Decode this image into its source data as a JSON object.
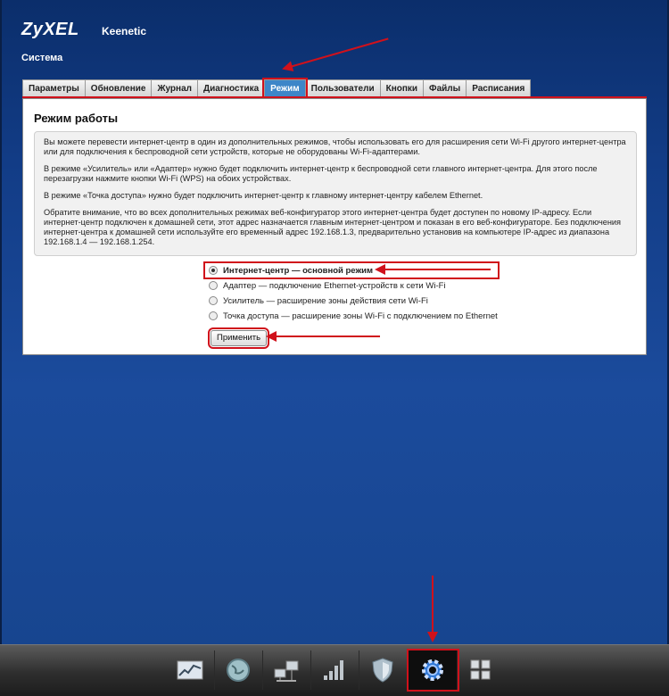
{
  "header": {
    "logo": "ZyXEL",
    "product": "Keenetic",
    "section_title": "Система"
  },
  "tabs": [
    {
      "label": "Параметры",
      "active": false
    },
    {
      "label": "Обновление",
      "active": false
    },
    {
      "label": "Журнал",
      "active": false
    },
    {
      "label": "Диагностика",
      "active": false
    },
    {
      "label": "Режим",
      "active": true
    },
    {
      "label": "Пользователи",
      "active": false
    },
    {
      "label": "Кнопки",
      "active": false
    },
    {
      "label": "Файлы",
      "active": false
    },
    {
      "label": "Расписания",
      "active": false
    }
  ],
  "panel": {
    "title": "Режим работы",
    "info": [
      "Вы можете перевести интернет-центр в один из дополнительных режимов, чтобы использовать его для расширения сети Wi-Fi другого интернет-центра или для подключения к беспроводной сети устройств, которые не оборудованы Wi-Fi-адаптерами.",
      "В режиме «Усилитель» или «Адаптер» нужно будет подключить интернет-центр к беспроводной сети главного интернет-центра. Для этого после перезагрузки нажмите кнопки Wi-Fi (WPS) на обоих устройствах.",
      "В режиме «Точка доступа» нужно будет подключить интернет-центр к главному интернет-центру кабелем Ethernet.",
      "Обратите внимание, что во всех дополнительных режимах веб-конфигуратор этого интернет-центра будет доступен по новому IP-адресу. Если интернет-центр подключен к домашней сети, этот адрес назначается главным интернет-центром и показан в его веб-конфигураторе. Без подключения интернет-центра к домашней сети используйте его временный адрес 192.168.1.3, предварительно установив на компьютере IP-адрес из диапазона 192.168.1.4 — 192.168.1.254."
    ],
    "modes": [
      {
        "label": "Интернет-центр — основной режим",
        "selected": true
      },
      {
        "label": "Адаптер — подключение Ethernet-устройств к сети Wi-Fi",
        "selected": false
      },
      {
        "label": "Усилитель — расширение зоны действия сети Wi-Fi",
        "selected": false
      },
      {
        "label": "Точка доступа — расширение зоны Wi-Fi с подключением по Ethernet",
        "selected": false
      }
    ],
    "apply_label": "Применить"
  },
  "taskbar": {
    "icons": [
      "monitor-chart-icon",
      "globe-icon",
      "network-computers-icon",
      "signal-bars-icon",
      "shield-icon",
      "gear-icon",
      "apps-grid-icon"
    ],
    "active": "gear-icon"
  },
  "colors": {
    "accent_red": "#d0111b",
    "active_tab": "#3d86c8",
    "background": "#123c86"
  }
}
